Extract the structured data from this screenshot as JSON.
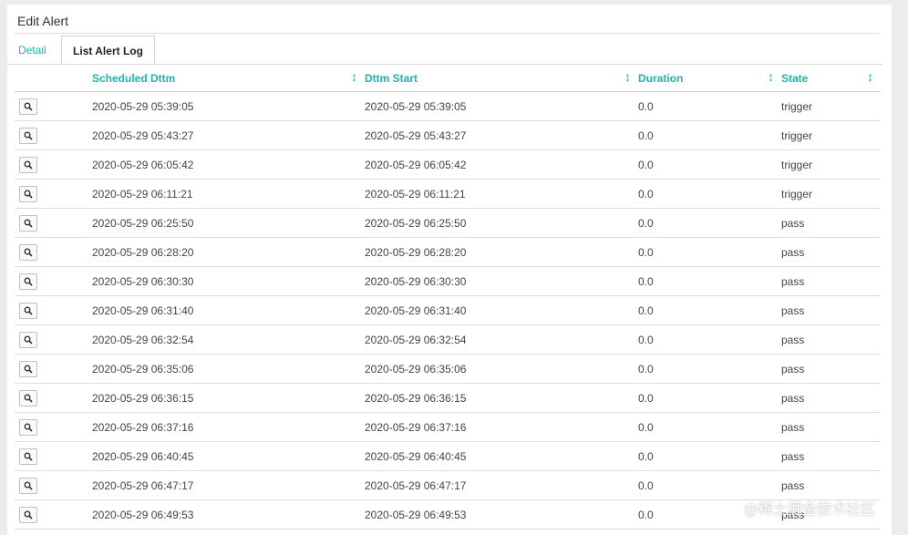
{
  "header": {
    "title": "Edit Alert"
  },
  "tabs": [
    {
      "label": "Detail",
      "active": false
    },
    {
      "label": "List Alert Log",
      "active": true
    }
  ],
  "table": {
    "columns": [
      "Scheduled Dttm",
      "Dttm Start",
      "Duration",
      "State"
    ],
    "sort_icon": "sort-icon",
    "view_icon": "magnifier-icon",
    "rows": [
      {
        "scheduled": "2020-05-29 05:39:05",
        "start": "2020-05-29 05:39:05",
        "duration": "0.0",
        "state": "trigger"
      },
      {
        "scheduled": "2020-05-29 05:43:27",
        "start": "2020-05-29 05:43:27",
        "duration": "0.0",
        "state": "trigger"
      },
      {
        "scheduled": "2020-05-29 06:05:42",
        "start": "2020-05-29 06:05:42",
        "duration": "0.0",
        "state": "trigger"
      },
      {
        "scheduled": "2020-05-29 06:11:21",
        "start": "2020-05-29 06:11:21",
        "duration": "0.0",
        "state": "trigger"
      },
      {
        "scheduled": "2020-05-29 06:25:50",
        "start": "2020-05-29 06:25:50",
        "duration": "0.0",
        "state": "pass"
      },
      {
        "scheduled": "2020-05-29 06:28:20",
        "start": "2020-05-29 06:28:20",
        "duration": "0.0",
        "state": "pass"
      },
      {
        "scheduled": "2020-05-29 06:30:30",
        "start": "2020-05-29 06:30:30",
        "duration": "0.0",
        "state": "pass"
      },
      {
        "scheduled": "2020-05-29 06:31:40",
        "start": "2020-05-29 06:31:40",
        "duration": "0.0",
        "state": "pass"
      },
      {
        "scheduled": "2020-05-29 06:32:54",
        "start": "2020-05-29 06:32:54",
        "duration": "0.0",
        "state": "pass"
      },
      {
        "scheduled": "2020-05-29 06:35:06",
        "start": "2020-05-29 06:35:06",
        "duration": "0.0",
        "state": "pass"
      },
      {
        "scheduled": "2020-05-29 06:36:15",
        "start": "2020-05-29 06:36:15",
        "duration": "0.0",
        "state": "pass"
      },
      {
        "scheduled": "2020-05-29 06:37:16",
        "start": "2020-05-29 06:37:16",
        "duration": "0.0",
        "state": "pass"
      },
      {
        "scheduled": "2020-05-29 06:40:45",
        "start": "2020-05-29 06:40:45",
        "duration": "0.0",
        "state": "pass"
      },
      {
        "scheduled": "2020-05-29 06:47:17",
        "start": "2020-05-29 06:47:17",
        "duration": "0.0",
        "state": "pass"
      },
      {
        "scheduled": "2020-05-29 06:49:53",
        "start": "2020-05-29 06:49:53",
        "duration": "0.0",
        "state": "pass"
      }
    ]
  },
  "watermark": "@稀土掘金技术社区",
  "colors": {
    "accent": "#1fb5a8",
    "text": "#444444",
    "border": "#dcdcdc"
  }
}
